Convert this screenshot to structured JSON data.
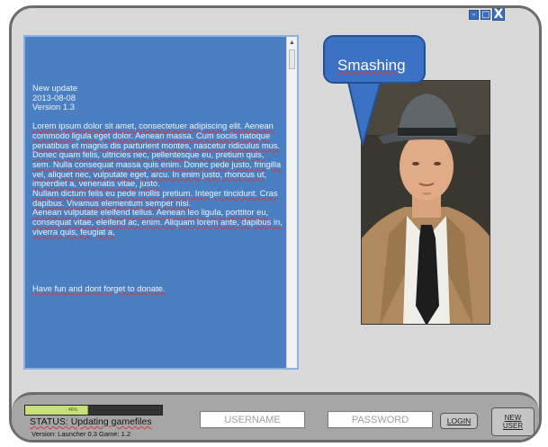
{
  "window_controls": {
    "minimize": "-",
    "maximize": "□",
    "close": "X"
  },
  "news": {
    "title": "New update",
    "date": "2013-08-08",
    "version": "Version 1.3",
    "paragraphs": [
      "Lorem ipsum dolor sit amet, consectetuer adipiscing elit. Aenean commodo ligula eget dolor. Aenean massa. Cum sociis natoque penatibus et magnis dis parturient montes, nascetur ridiculus mus.",
      "Donec quam felis, ultricies nec, pellentesque eu, pretium quis, sem. Nulla consequat massa quis enim. Donec pede justo, fringilla vel, aliquet nec, vulputate eget, arcu. In enim justo, rhoncus ut, imperdiet a, venenatis vitae, justo.",
      "Nullam dictum felis eu pede mollis pretium. Integer tincidunt. Cras dapibus. Vivamus elementum semper nisi.",
      "Aenean vulputate eleifend tellus. Aenean leo ligula, porttitor eu, consequat vitae, eleifend ac, enim. Aliquam lorem ante, dapibus in, viverra quis, feugiat a,"
    ],
    "closing": "Have fun and dont forget to donate."
  },
  "speech_bubble": {
    "text": "Smashing"
  },
  "footer": {
    "progress": {
      "percent": 46,
      "label": "46%"
    },
    "status": "STATUS: Updating gamefiles",
    "version": "Version: Launcher 0.3 Game: 1.2",
    "username_placeholder": "USERNAME",
    "password_placeholder": "PASSWORD",
    "login_label": "LOGIN",
    "new_user_label_1": "NEW",
    "new_user_label_2": "USER"
  },
  "colors": {
    "news_bg": "#4a7fc1",
    "bubble_bg": "#3b72c6",
    "window_bg": "#d9d9d9",
    "footer_bg": "#a6a6a6",
    "progress_fill": "#c7e07a"
  }
}
